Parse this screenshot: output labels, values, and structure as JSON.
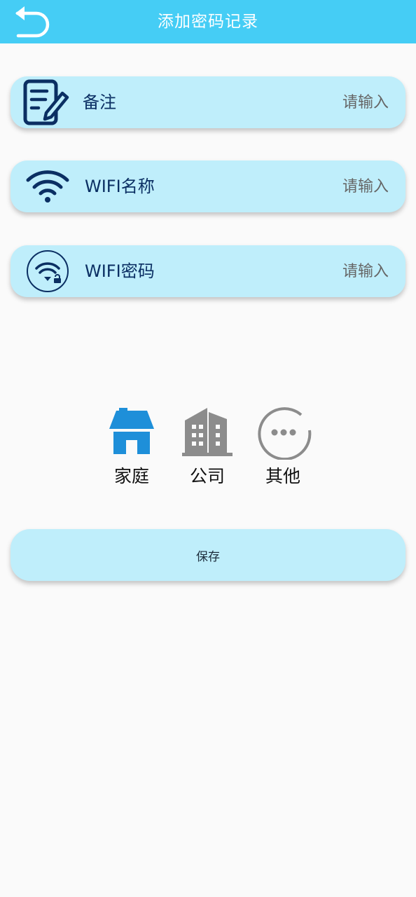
{
  "header": {
    "title": "添加密码记录",
    "back_icon": "back-arrow-icon",
    "background_color": "#45cdf5"
  },
  "form": {
    "fields": [
      {
        "label": "备注",
        "placeholder": "请输入",
        "value": "",
        "icon": "edit-note-icon"
      },
      {
        "label": "WIFI名称",
        "placeholder": "请输入",
        "value": "",
        "icon": "wifi-icon"
      },
      {
        "label": "WIFI密码",
        "placeholder": "请输入",
        "value": "",
        "icon": "wifi-lock-icon"
      }
    ],
    "row_color": "#bfeefb",
    "label_color": "#0b2f63"
  },
  "categories": {
    "items": [
      {
        "label": "家庭",
        "icon": "home-icon",
        "color": "#1e8fd9",
        "selected": true
      },
      {
        "label": "公司",
        "icon": "building-icon",
        "color": "#8c8c8c",
        "selected": false
      },
      {
        "label": "其他",
        "icon": "more-circle-icon",
        "color": "#8c8c8c",
        "selected": false
      }
    ]
  },
  "actions": {
    "save_label": "保存"
  }
}
